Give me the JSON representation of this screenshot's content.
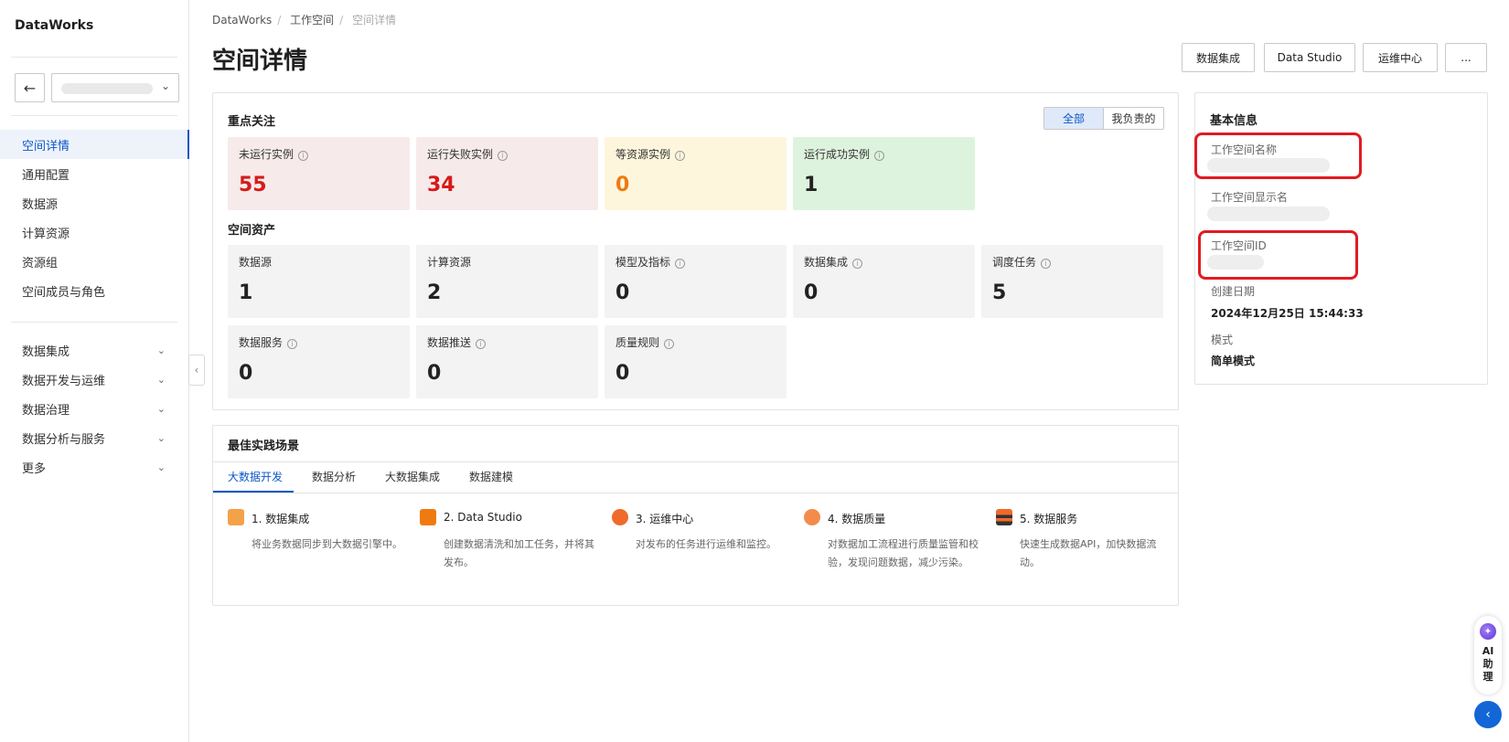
{
  "sidebar": {
    "brand": "DataWorks",
    "back_icon": "←",
    "select_chevron": "⌄",
    "items": [
      {
        "label": "空间详情"
      },
      {
        "label": "通用配置"
      },
      {
        "label": "数据源"
      },
      {
        "label": "计算资源"
      },
      {
        "label": "资源组"
      },
      {
        "label": "空间成员与角色"
      }
    ],
    "groups": [
      {
        "label": "数据集成"
      },
      {
        "label": "数据开发与运维"
      },
      {
        "label": "数据治理"
      },
      {
        "label": "数据分析与服务"
      },
      {
        "label": "更多"
      }
    ],
    "caret": "⌄",
    "collapse_icon": "‹"
  },
  "breadcrumb": {
    "items": [
      "DataWorks",
      "工作空间",
      "空间详情"
    ],
    "sep": "/"
  },
  "header": {
    "title": "空间详情",
    "buttons": [
      "数据集成",
      "Data Studio",
      "运维中心",
      "..."
    ]
  },
  "focus": {
    "title": "重点关注",
    "toggle": {
      "all": "全部",
      "mine": "我负责的"
    },
    "cards": [
      {
        "label": "未运行实例",
        "value": "55"
      },
      {
        "label": "运行失败实例",
        "value": "34"
      },
      {
        "label": "等资源实例",
        "value": "0"
      },
      {
        "label": "运行成功实例",
        "value": "1"
      }
    ]
  },
  "assets": {
    "title": "空间资产",
    "cards": [
      {
        "label": "数据源",
        "value": "1"
      },
      {
        "label": "计算资源",
        "value": "2"
      },
      {
        "label": "模型及指标",
        "value": "0"
      },
      {
        "label": "数据集成",
        "value": "0"
      },
      {
        "label": "调度任务",
        "value": "5"
      },
      {
        "label": "数据服务",
        "value": "0"
      },
      {
        "label": "数据推送",
        "value": "0"
      },
      {
        "label": "质量规则",
        "value": "0"
      }
    ],
    "info_glyph": "i"
  },
  "basic_info": {
    "title": "基本信息",
    "ws_name_label": "工作空间名称",
    "ws_display_label": "工作空间显示名",
    "ws_id_label": "工作空间ID",
    "created_label": "创建日期",
    "created_value": "2024年12月25日 15:44:33",
    "mode_label": "模式",
    "mode_value": "简单模式"
  },
  "best_practice": {
    "title": "最佳实践场景",
    "tabs": [
      "大数据开发",
      "数据分析",
      "大数据集成",
      "数据建模"
    ],
    "steps": [
      {
        "title": "1. 数据集成",
        "desc": "将业务数据同步到大数据引擎中。",
        "icon": "integration-icon"
      },
      {
        "title": "2. Data Studio",
        "desc": "创建数据清洗和加工任务，并将其发布。",
        "icon": "data-studio-icon"
      },
      {
        "title": "3. 运维中心",
        "desc": "对发布的任务进行运维和监控。",
        "icon": "operation-center-icon"
      },
      {
        "title": "4. 数据质量",
        "desc": "对数据加工流程进行质量监管和校验，发现问题数据，减少污染。",
        "icon": "data-quality-icon"
      },
      {
        "title": "5. 数据服务",
        "desc": "快速生成数据API，加快数据流动。",
        "icon": "data-service-icon"
      }
    ]
  },
  "ai_helper": {
    "label": "AI助理",
    "line1": "AI",
    "line2": "助",
    "line3": "理",
    "star": "✦",
    "back": "‹"
  },
  "colors": {
    "accent": "#0b56c6",
    "red": "#d61a1a",
    "orange": "#ef7a12",
    "highlight_box": "#e11b22"
  }
}
